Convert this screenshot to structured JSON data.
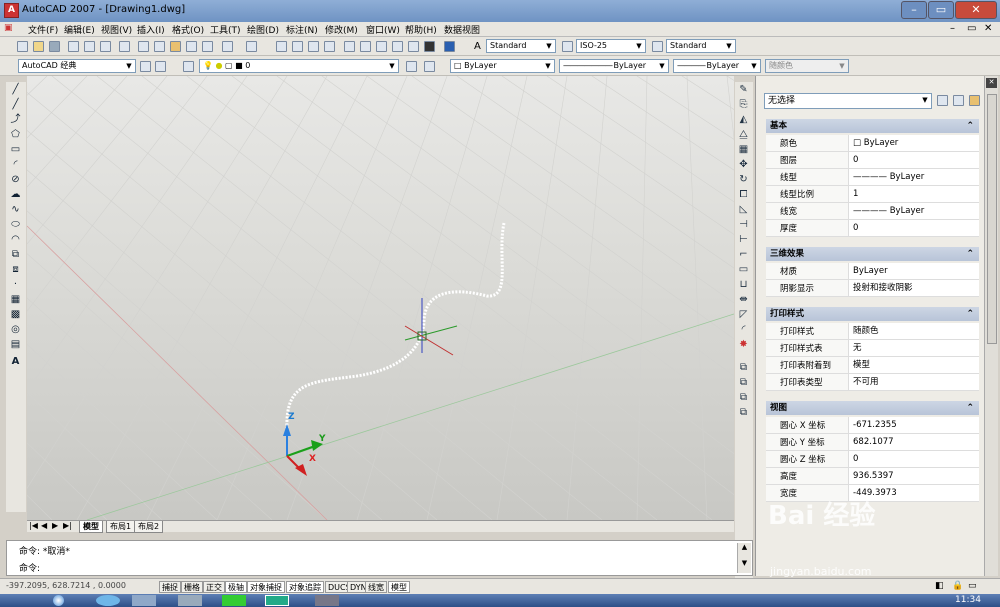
{
  "window": {
    "title": "AutoCAD 2007 - [Drawing1.dwg]",
    "icon": "autocad-app-icon"
  },
  "menu": [
    "文件(F)",
    "编辑(E)",
    "视图(V)",
    "插入(I)",
    "格式(O)",
    "工具(T)",
    "绘图(D)",
    "标注(N)",
    "修改(M)",
    "窗口(W)",
    "帮助(H)",
    "数据视图"
  ],
  "toolbar1": {
    "text_style": "Standard",
    "dim_style": "ISO-25",
    "table_style": "Standard"
  },
  "toolbar2": {
    "workspace": "AutoCAD 经典",
    "layer": "0",
    "color": "ByLayer",
    "linetype": "ByLayer",
    "lineweight": "ByLayer",
    "plotstyle": "随颜色"
  },
  "ucs": {
    "x": "X",
    "y": "Y",
    "z": "Z"
  },
  "layout_tabs": [
    "模型",
    "布局1",
    "布局2"
  ],
  "command": {
    "line1": "命令: *取消*",
    "line2": "命令:"
  },
  "status": {
    "coords": "-397.2095, 628.7214 , 0.0000",
    "buttons": [
      "捕捉",
      "栅格",
      "正交",
      "极轴",
      "对象捕捉",
      "对象追踪",
      "DUCS",
      "DYN",
      "线宽",
      "模型"
    ]
  },
  "properties": {
    "selection": "无选择",
    "sections": [
      {
        "title": "基本",
        "rows": [
          [
            "颜色",
            "□ ByLayer"
          ],
          [
            "图层",
            "0"
          ],
          [
            "线型",
            "———— ByLayer"
          ],
          [
            "线型比例",
            "1"
          ],
          [
            "线宽",
            "———— ByLayer"
          ],
          [
            "厚度",
            "0"
          ]
        ]
      },
      {
        "title": "三维效果",
        "rows": [
          [
            "材质",
            "ByLayer"
          ],
          [
            "阴影显示",
            "投射和接收阴影"
          ]
        ]
      },
      {
        "title": "打印样式",
        "rows": [
          [
            "打印样式",
            "随颜色"
          ],
          [
            "打印样式表",
            "无"
          ],
          [
            "打印表附着到",
            "模型"
          ],
          [
            "打印表类型",
            "不可用"
          ]
        ]
      },
      {
        "title": "视图",
        "rows": [
          [
            "圆心 X 坐标",
            "-671.2355"
          ],
          [
            "圆心 Y 坐标",
            "682.1077"
          ],
          [
            "圆心 Z 坐标",
            "0"
          ],
          [
            "高度",
            "936.5397"
          ],
          [
            "宽度",
            "-449.3973"
          ]
        ]
      }
    ]
  },
  "taskbar": {
    "clock": "11:34"
  },
  "watermark": {
    "main": "Bai 经验",
    "sub": "jingyan.baidu.com"
  }
}
